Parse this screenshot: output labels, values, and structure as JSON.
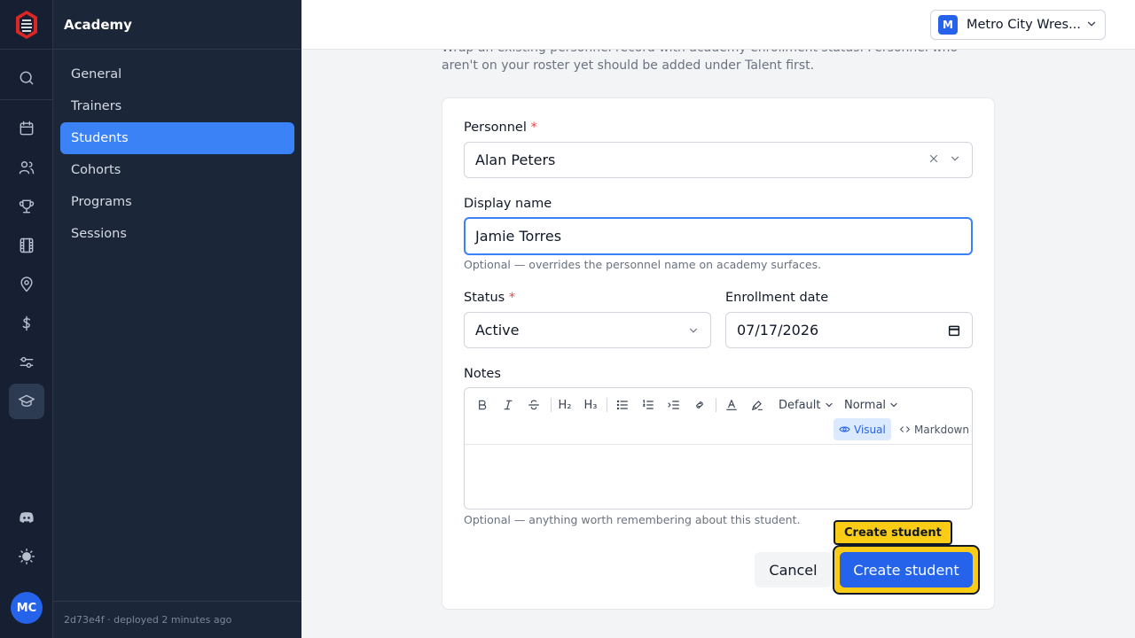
{
  "rail": {
    "icons": [
      "logo-icon",
      "search-icon",
      "calendar-icon",
      "users-icon",
      "trophy-icon",
      "film-icon",
      "map-pin-icon",
      "dollar-icon",
      "sliders-icon",
      "graduation-cap-icon",
      "discord-icon",
      "sun-icon"
    ],
    "avatar_initials": "MC"
  },
  "subnav": {
    "title": "Academy",
    "items": [
      {
        "label": "General"
      },
      {
        "label": "Trainers"
      },
      {
        "label": "Students"
      },
      {
        "label": "Cohorts"
      },
      {
        "label": "Programs"
      },
      {
        "label": "Sessions"
      }
    ],
    "active_item": "Students",
    "footer": "2d73e4f · deployed 2 minutes ago"
  },
  "topbar": {
    "org_badge": "M",
    "org_name": "Metro City Wres..."
  },
  "form": {
    "intro": "Wrap an existing personnel record with academy enrollment status. Personnel who aren't on your roster yet should be added under Talent first.",
    "personnel_label": "Personnel",
    "personnel_value": "Alan Peters",
    "display_name_label": "Display name",
    "display_name_value": "Jamie Torres",
    "display_name_hint": "Optional — overrides the personnel name on academy surfaces.",
    "status_label": "Status",
    "status_value": "Active",
    "enrollment_label": "Enrollment date",
    "enrollment_value": "07/17/2026",
    "notes_label": "Notes",
    "notes_hint": "Optional — anything worth remembering about this student.",
    "required_marker": "*",
    "toolbar": {
      "h2": "H₂",
      "h3": "H₃",
      "font_family": "Default",
      "font_size": "Normal",
      "visual_label": "Visual",
      "markdown_label": "Markdown"
    },
    "cancel_label": "Cancel",
    "create_label": "Create student",
    "tooltip": "Create student"
  },
  "colors": {
    "accent": "#2563eb",
    "highlight": "#facc15",
    "sidebar_bg": "#1b2638",
    "rail_bg": "#162032"
  }
}
